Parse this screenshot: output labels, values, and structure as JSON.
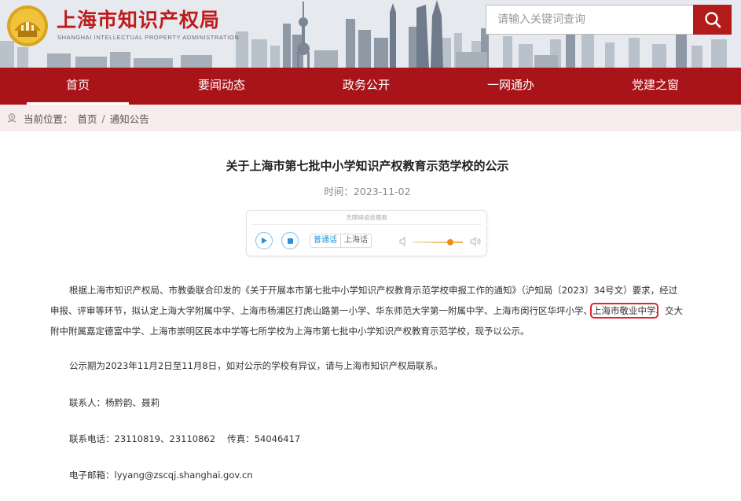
{
  "header": {
    "title": "上海市知识产权局",
    "subtitle": "SHANGHAI INTELLECTUAL PROPERTY ADMINISTRATION",
    "search_placeholder": "请输入关键词查询",
    "brand_color": "#a8141a",
    "icons": {
      "logo": "emblem-logo",
      "search": "search-icon"
    }
  },
  "nav": {
    "items": [
      {
        "label": "首页",
        "active": true
      },
      {
        "label": "要闻动态",
        "active": false
      },
      {
        "label": "政务公开",
        "active": false
      },
      {
        "label": "一网通办",
        "active": false
      },
      {
        "label": "党建之窗",
        "active": false
      }
    ]
  },
  "breadcrumb": {
    "prefix": "当前位置：",
    "items": [
      "首页",
      "通知公告"
    ],
    "separator": "/",
    "icon": "location-icon"
  },
  "article": {
    "title": "关于上海市第七批中小学知识产权教育示范学校的公示",
    "date_label": "时间：",
    "date": "2023-11-02"
  },
  "player": {
    "header": "无障碍语音播报",
    "language_options": [
      "普通话",
      "上海话"
    ],
    "selected_language": "普通话",
    "volume_fraction": 0.75,
    "icons": [
      "play-icon",
      "stop-icon",
      "volume-low-icon",
      "volume-high-icon"
    ]
  },
  "content": {
    "p1_before": "根据上海市知识产权局、市教委联合印发的《关于开展本市第七批中小学知识产权教育示范学校申报工作的通知》（沪知局〔2023〕34号文）要求，经过申报、评审等环节，拟认定上海大学附属中学、上海市杨浦区打虎山路第一小学、华东师范大学第一附属中学、上海市闵行区华坪小学、",
    "p1_highlight": "上海市敬业中学",
    "p1_after": "、交大附中附属嘉定德富中学、上海市崇明区民本中学等七所学校为上海市第七批中小学知识产权教育示范学校，现予以公示。",
    "p2": "公示期为2023年11月2日至11月8日，如对公示的学校有异议，请与上海市知识产权局联系。",
    "p3": "联系人：杨黔韵、聂莉",
    "p4": "联系电话：23110819、23110862　  传真：54046417",
    "p5": "电子邮箱：lyyang@zscqj.shanghai.gov.cn",
    "highlight_color": "#e0262d"
  }
}
